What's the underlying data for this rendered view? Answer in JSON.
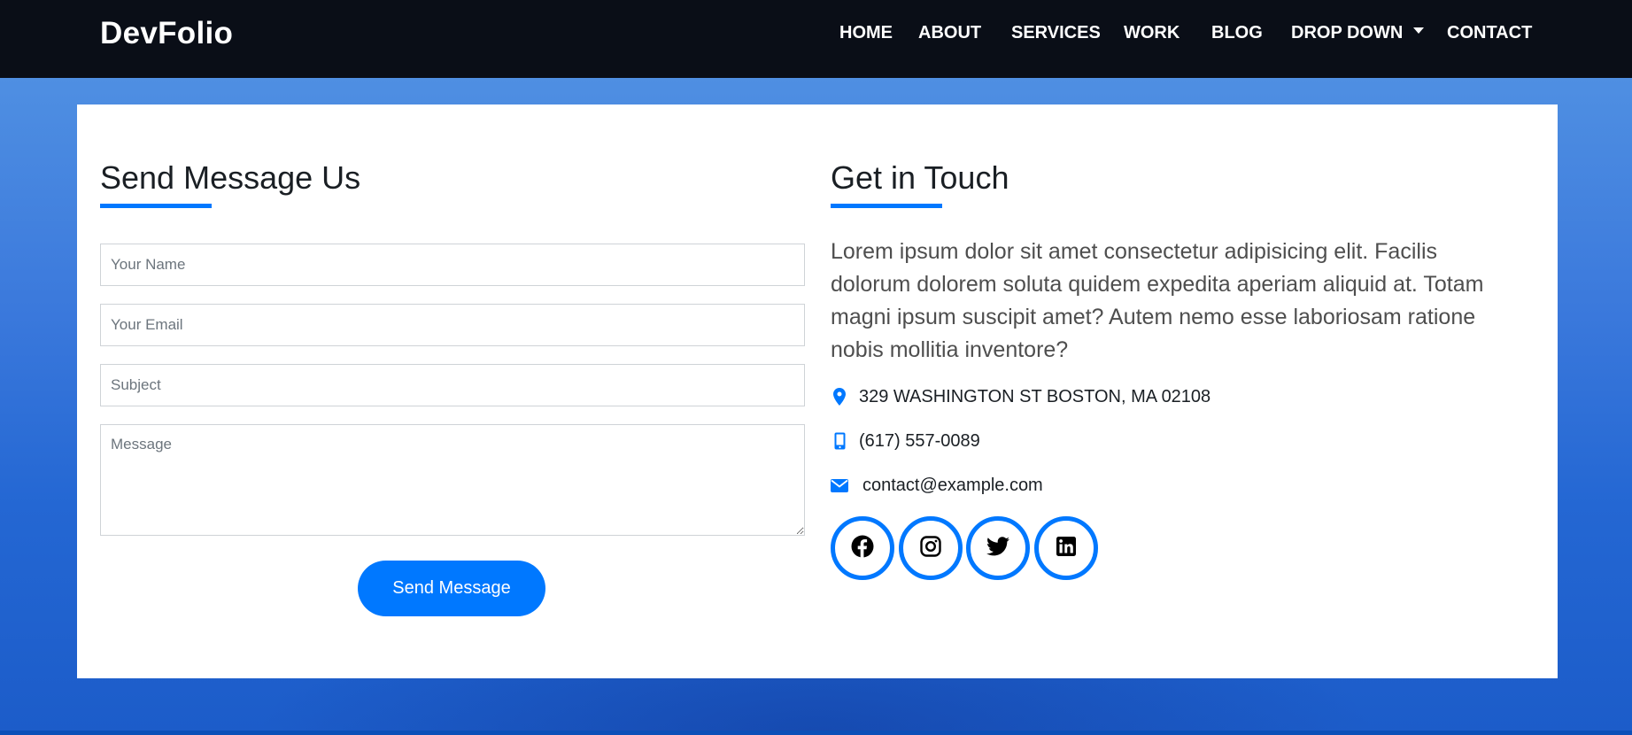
{
  "brand": "DevFolio",
  "nav": {
    "home": "HOME",
    "about": "ABOUT",
    "services": "SERVICES",
    "work": "WORK",
    "blog": "BLOG",
    "dropdown": "DROP DOWN",
    "contact": "CONTACT"
  },
  "form": {
    "title": "Send Message Us",
    "name_placeholder": "Your Name",
    "email_placeholder": "Your Email",
    "subject_placeholder": "Subject",
    "message_placeholder": "Message",
    "submit_label": "Send Message"
  },
  "touch": {
    "title": "Get in Touch",
    "description": "Lorem ipsum dolor sit amet consectetur adipisicing elit. Facilis dolorum dolorem soluta quidem expedita aperiam aliquid at. Totam magni ipsum suscipit amet? Autem nemo esse laboriosam ratione nobis mollitia inventore?",
    "address": "329 WASHINGTON ST BOSTON, MA 02108",
    "phone": "(617) 557-0089",
    "email": "contact@example.com"
  },
  "social": [
    "facebook-icon",
    "instagram-icon",
    "twitter-icon",
    "linkedin-icon"
  ],
  "colors": {
    "accent": "#0078ff",
    "navbar": "#0a0e17",
    "background": "#2467d3",
    "text": "#1a1f24"
  }
}
